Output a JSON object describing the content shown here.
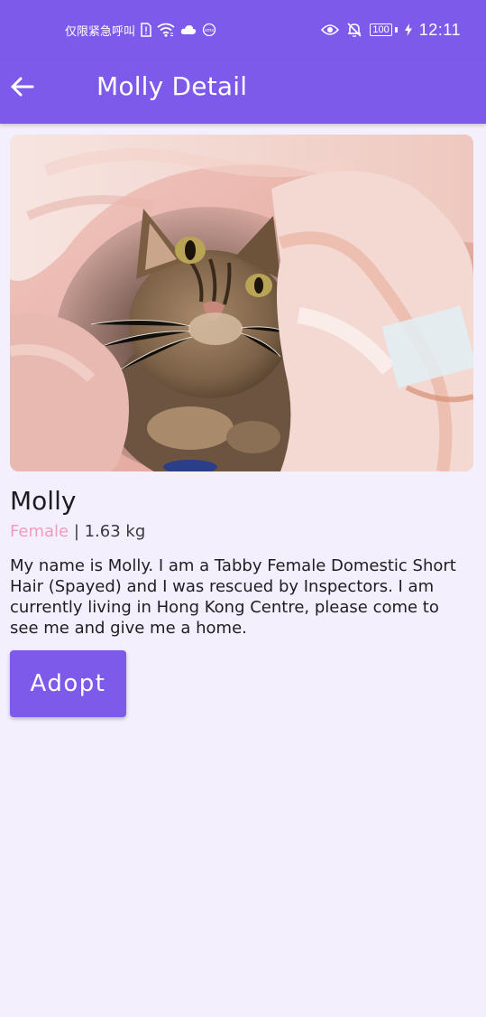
{
  "status_bar": {
    "carrier_text": "仅限紧急呼叫",
    "time": "12:11",
    "battery_level": "100",
    "icons": [
      "sim-alert-icon",
      "wifi-icon",
      "cloud-icon",
      "sms-icon",
      "eye-icon",
      "bell-off-icon",
      "battery-icon",
      "charging-icon"
    ]
  },
  "app_bar": {
    "title": "Molly Detail",
    "back_icon": "arrow-left-icon"
  },
  "pet": {
    "name": "Molly",
    "gender": "Female",
    "separator": " | ",
    "weight": "1.63 kg",
    "description": "My name is Molly. I am a Tabby Female Domestic Short Hair (Spayed) and I was rescued by Inspectors. I am currently living in Hong Kong Centre, please come to see me and give me a home.",
    "photo": "tabby-cat-under-blanket"
  },
  "actions": {
    "adopt_label": "Adopt"
  },
  "colors": {
    "primary": "#7E5AEB",
    "background": "#F3EFFC",
    "gender_female": "#F29BC0"
  }
}
